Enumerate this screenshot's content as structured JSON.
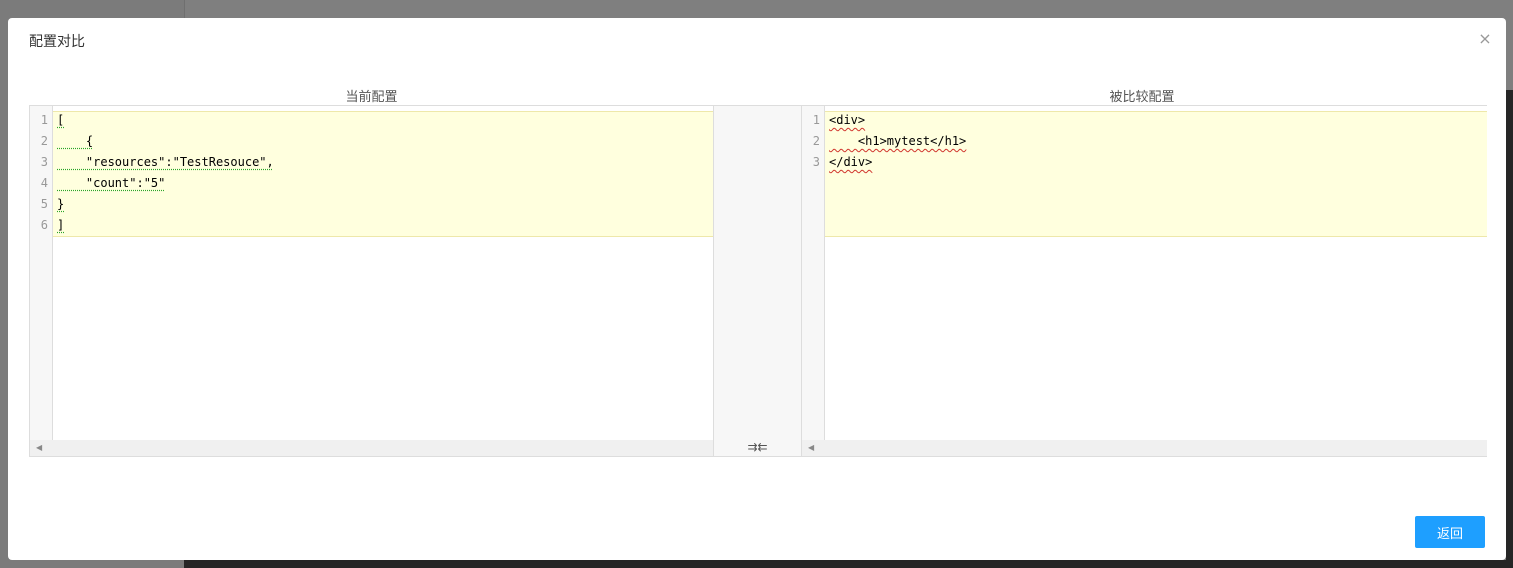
{
  "dialog": {
    "title": "配置对比",
    "close_icon": "×",
    "back_label": "返回"
  },
  "left_pane": {
    "label": "当前配置",
    "line_numbers": [
      "1",
      "2",
      "3",
      "4",
      "5",
      "6"
    ],
    "lines": [
      "[",
      "    {",
      "    \"resources\":\"TestResouce\",",
      "    \"count\":\"5\"",
      "}",
      "]"
    ]
  },
  "right_pane": {
    "label": "被比较配置",
    "line_numbers": [
      "1",
      "2",
      "3"
    ],
    "lines": [
      "<div>",
      "    <h1>mytest</h1>",
      "</div>"
    ]
  },
  "merge": {
    "icon": "⇉⇇"
  },
  "colors": {
    "accent": "#1e9fff",
    "diff_highlight": "#ffffde"
  }
}
